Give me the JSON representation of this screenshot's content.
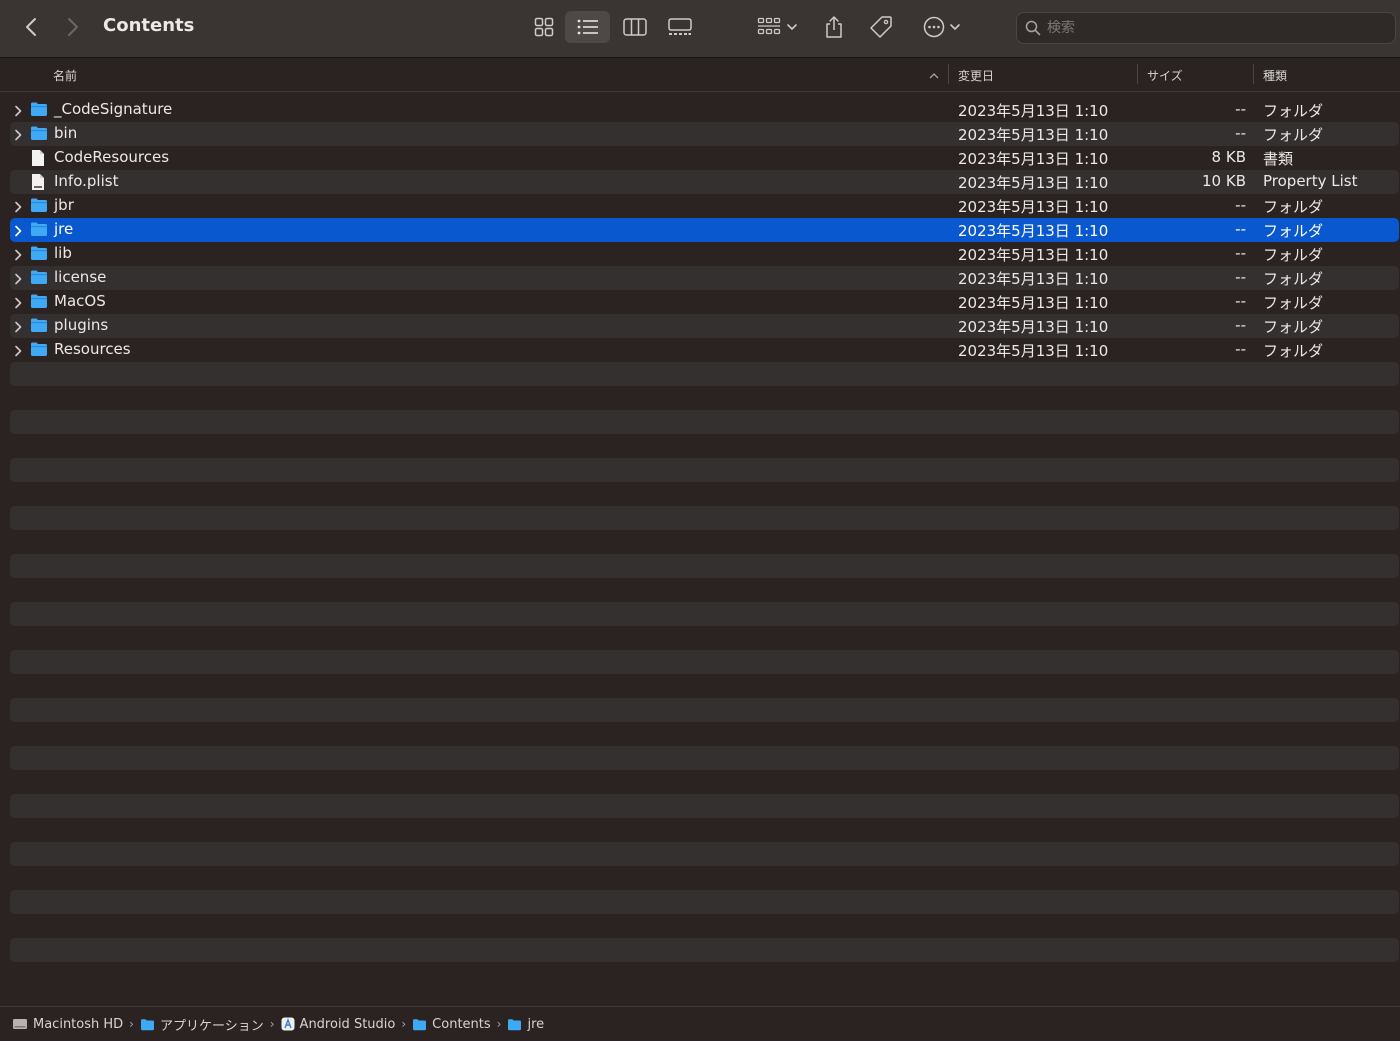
{
  "window": {
    "title": "Contents",
    "search_placeholder": "検索"
  },
  "columns": {
    "name": "名前",
    "date": "変更日",
    "size": "サイズ",
    "kind": "種類"
  },
  "files": [
    {
      "name": "_CodeSignature",
      "date": "2023年5月13日 1:10",
      "size": "--",
      "kind": "フォルダ",
      "type": "folder"
    },
    {
      "name": "bin",
      "date": "2023年5月13日 1:10",
      "size": "--",
      "kind": "フォルダ",
      "type": "folder"
    },
    {
      "name": "CodeResources",
      "date": "2023年5月13日 1:10",
      "size": "8 KB",
      "kind": "書類",
      "type": "document"
    },
    {
      "name": "Info.plist",
      "date": "2023年5月13日 1:10",
      "size": "10 KB",
      "kind": "Property List",
      "type": "plist"
    },
    {
      "name": "jbr",
      "date": "2023年5月13日 1:10",
      "size": "--",
      "kind": "フォルダ",
      "type": "folder"
    },
    {
      "name": "jre",
      "date": "2023年5月13日 1:10",
      "size": "--",
      "kind": "フォルダ",
      "type": "folder",
      "selected": true
    },
    {
      "name": "lib",
      "date": "2023年5月13日 1:10",
      "size": "--",
      "kind": "フォルダ",
      "type": "folder"
    },
    {
      "name": "license",
      "date": "2023年5月13日 1:10",
      "size": "--",
      "kind": "フォルダ",
      "type": "folder"
    },
    {
      "name": "MacOS",
      "date": "2023年5月13日 1:10",
      "size": "--",
      "kind": "フォルダ",
      "type": "folder"
    },
    {
      "name": "plugins",
      "date": "2023年5月13日 1:10",
      "size": "--",
      "kind": "フォルダ",
      "type": "folder"
    },
    {
      "name": "Resources",
      "date": "2023年5月13日 1:10",
      "size": "--",
      "kind": "フォルダ",
      "type": "folder"
    }
  ],
  "path": [
    {
      "label": "Macintosh HD",
      "icon": "disk-icon"
    },
    {
      "label": "アプリケーション",
      "icon": "folder-icon"
    },
    {
      "label": "Android Studio",
      "icon": "app-icon"
    },
    {
      "label": "Contents",
      "icon": "folder-icon"
    },
    {
      "label": "jre",
      "icon": "folder-icon"
    }
  ],
  "colors": {
    "selection": "#0a58d0",
    "folder": "#3fa9f5"
  }
}
